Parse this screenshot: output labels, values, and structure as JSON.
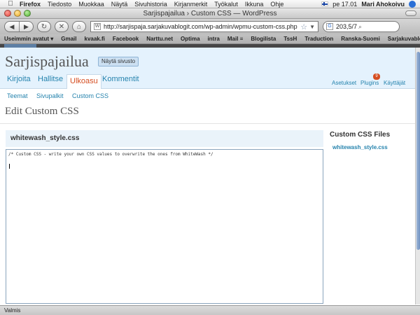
{
  "menubar": {
    "app": "Firefox",
    "items": [
      "Tiedosto",
      "Muokkaa",
      "Näytä",
      "Sivuhistoria",
      "Kirjanmerkit",
      "Työkalut",
      "Ikkuna",
      "Ohje"
    ],
    "clock": "pe 17.01",
    "user": "Mari Ahokoivu"
  },
  "window": {
    "title": "Sarjispajailua › Custom CSS — WordPress"
  },
  "toolbar": {
    "url": "http://sarjispaja.sarjakuvablogit.com/wp-admin/wpmu-custom-css.php",
    "search_value": "203,5/7"
  },
  "bookmarks": [
    "Useimmin avatut ▾",
    "Gmail",
    "kvaak.fi",
    "Facebook",
    "Narttu.net",
    "Optima",
    "intra",
    "Mail ≡",
    "Blogilista",
    "TssH",
    "Traduction",
    "Ranska-Suomi",
    "Sarjakuvablogit"
  ],
  "wp": {
    "site_name": "Sarjispajailua",
    "view_site": "Näytä sivusto",
    "nav": [
      "Kirjoita",
      "Hallitse",
      "Ulkoasu",
      "Kommentit"
    ],
    "util": [
      "Asetukset",
      "Plugins",
      "Käyttäjät"
    ],
    "plugins_badge": "9",
    "subnav": [
      "Teemat",
      "Sivupalkit",
      "Custom CSS"
    ],
    "page_title": "Edit Custom CSS",
    "file_title": "whitewash_style.css",
    "editor_text": "/* Custom CSS - write your own CSS values to overwrite the ones from WhiteWash */",
    "side_heading": "Custom CSS Files",
    "side_file": "whitewash_style.css"
  },
  "status": "Valmis",
  "colors": {
    "accent": "#2583ad",
    "active_tab": "#d54e21",
    "header_bg": "#e4f2fd"
  }
}
